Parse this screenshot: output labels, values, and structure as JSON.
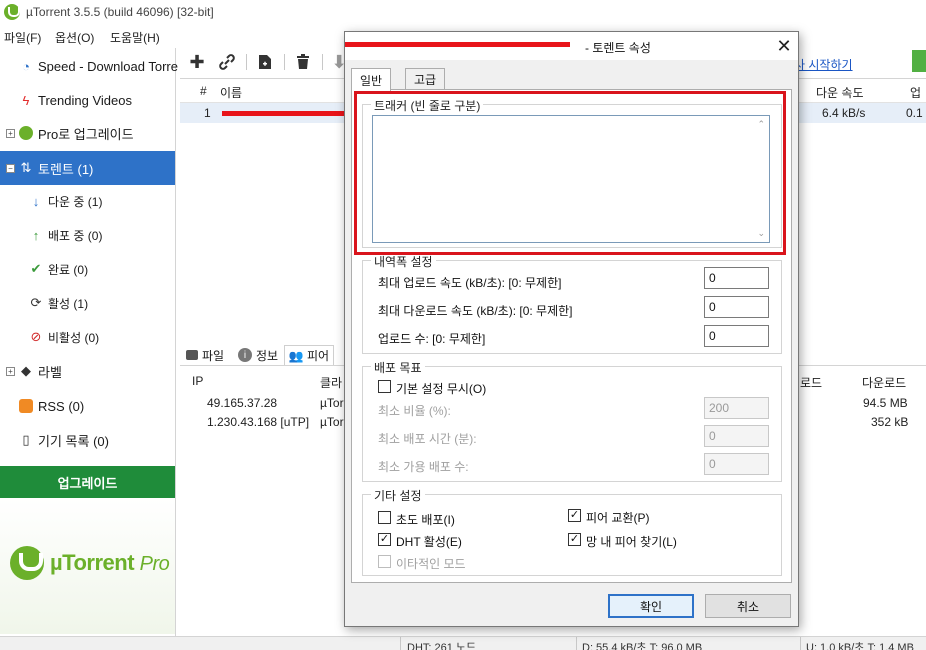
{
  "app": {
    "title": "µTorrent 3.5.5  (build 46096) [32-bit]"
  },
  "menu": [
    "파일(F)",
    "옵션(O)",
    "도움말(H)"
  ],
  "toolbar": {
    "link": "사 시작하기"
  },
  "sidebar": {
    "items": [
      {
        "label": "Speed - Download Torre",
        "icon": "speedometer-icon"
      },
      {
        "label": "Trending Videos",
        "icon": "lightning-icon"
      },
      {
        "label": "Pro로 업그레이드",
        "icon": "utorrent-icon"
      },
      {
        "label": "토렌트 (1)",
        "icon": "torrents-icon"
      },
      {
        "label": "다운 중 (1)",
        "icon": "download-arrow-icon"
      },
      {
        "label": "배포 중 (0)",
        "icon": "upload-arrow-icon"
      },
      {
        "label": "완료 (0)",
        "icon": "check-icon"
      },
      {
        "label": "활성 (1)",
        "icon": "refresh-icon"
      },
      {
        "label": "비활성 (0)",
        "icon": "inactive-icon"
      },
      {
        "label": "라벨",
        "icon": "tag-icon"
      },
      {
        "label": "RSS (0)",
        "icon": "rss-icon"
      },
      {
        "label": "기기 목록 (0)",
        "icon": "device-icon"
      }
    ],
    "upgrade": "업그레이드",
    "promo_brand": "µTorrent",
    "promo_suffix": "Pro"
  },
  "torrent_list": {
    "columns": [
      "#",
      "이름",
      "다운 속도",
      "업"
    ],
    "rows": [
      {
        "num": "1",
        "down_speed": "6.4 kB/s",
        "up": "0.1"
      }
    ]
  },
  "detail_tabs": [
    "파일",
    "정보",
    "피어"
  ],
  "peers": {
    "columns": [
      "IP",
      "클라",
      "로드",
      "다운로드"
    ],
    "rows": [
      {
        "ip": "49.165.37.28",
        "client": "µTorr",
        "downloaded": "94.5 MB"
      },
      {
        "ip": "1.230.43.168 [uTP]",
        "client": "µTorr",
        "downloaded": "352 kB"
      }
    ]
  },
  "status": {
    "dht": "DHT: 261 노드",
    "download": "D: 55.4 kB/초 T: 96.0 MB",
    "upload": "U: 1.0 kB/초 T: 1.4 MB"
  },
  "dialog": {
    "title": "- 토렌트 속성",
    "tabs": [
      "일반",
      "고급"
    ],
    "tracker_group": "트래커 (빈 줄로 구분)",
    "bandwidth_group": "내역폭 설정",
    "max_upload": "최대 업로드 속도 (kB/초): [0: 무제한]",
    "max_download": "최대 다운로드 속도 (kB/초): [0: 무제한]",
    "upload_slots": "업로드 수: [0: 무제한]",
    "max_upload_value": "0",
    "max_download_value": "0",
    "upload_slots_value": "0",
    "seed_group": "배포 목표",
    "ignore_default": "기본 설정 무시(O)",
    "min_ratio": "최소 비율 (%):",
    "min_ratio_value": "200",
    "min_seed_time": "최소 배포 시간 (분):",
    "min_seed_time_value": "0",
    "min_availability": "최소 가용 배포 수:",
    "min_availability_value": "0",
    "other_group": "기타 설정",
    "super_seed": "초도 배포(I)",
    "dht": "DHT 활성(E)",
    "sequential": "이타적인 모드",
    "peer_exchange": "피어 교환(P)",
    "local_peer": "망 내 피어 찾기(L)",
    "ok": "확인",
    "cancel": "취소"
  },
  "colors": {
    "accent": "#2e72c8",
    "highlight": "#d9141c",
    "brand_green": "#6bb02a",
    "upgrade_green": "#1f8c3a"
  }
}
